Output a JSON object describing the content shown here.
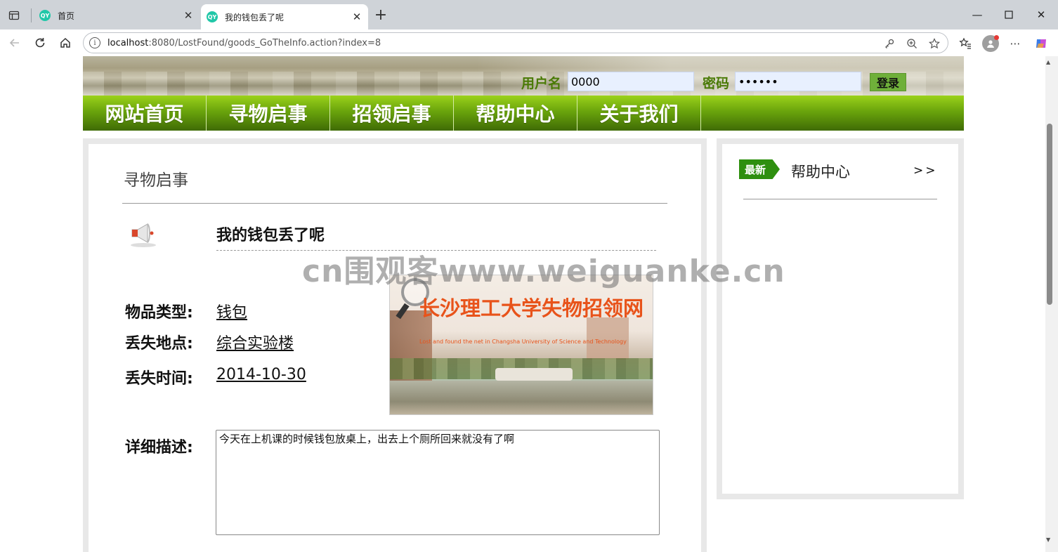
{
  "browser": {
    "tabs": [
      {
        "favicon": "QY",
        "title": "首页"
      },
      {
        "favicon": "QY",
        "title": "我的钱包丢了呢"
      }
    ],
    "address": {
      "host": "localhost",
      "path": ":8080/LostFound/goods_GoTheInfo.action?index=8"
    }
  },
  "header": {
    "username_label": "用户名",
    "username_value": "0000",
    "password_label": "密码",
    "password_value": "••••••",
    "login_button": "登录"
  },
  "nav": {
    "items": [
      "网站首页",
      "寻物启事",
      "招领启事",
      "帮助中心",
      "关于我们"
    ]
  },
  "main": {
    "section_title": "寻物启事",
    "item_title": "我的钱包丢了呢",
    "fields": [
      {
        "label": "物品类型:",
        "value": "钱包"
      },
      {
        "label": "丢失地点:",
        "value": "综合实验楼"
      },
      {
        "label": "丢失时间:",
        "value": "2014-10-30"
      }
    ],
    "image": {
      "title": "长沙理工大学失物招领网",
      "subtitle": "Lost and found the net in Changsha University of Science and Technology"
    },
    "description_label": "详细描述:",
    "description": "今天在上机课的时候钱包放桌上，出去上个厕所回来就没有了啊"
  },
  "sidebar": {
    "badge": "最新",
    "title": "帮助中心",
    "more": ">>"
  },
  "watermark": "cn围观客www.weiguanke.cn",
  "colors": {
    "nav_green": "#6aa40c",
    "label_green": "#4a7a06",
    "badge_green": "#2e8f0f",
    "image_title": "#e8531a"
  }
}
